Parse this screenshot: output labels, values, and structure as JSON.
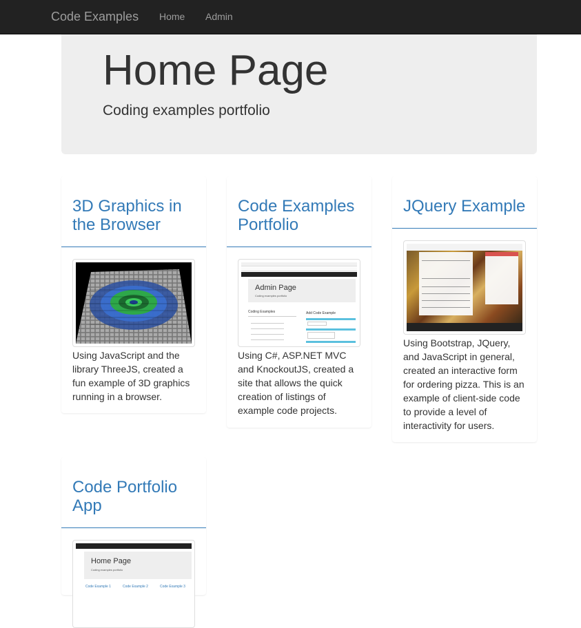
{
  "navbar": {
    "brand": "Code Examples",
    "links": [
      "Home",
      "Admin"
    ]
  },
  "jumbotron": {
    "title": "Home Page",
    "subtitle": "Coding examples portfolio"
  },
  "cards": [
    {
      "title": "3D Graphics in the Browser",
      "text": "Using JavaScript and the library ThreeJS, created a fun example of 3D graphics running in a browser."
    },
    {
      "title": "Code Examples Portfolio",
      "text": "Using C#, ASP.NET MVC and KnockoutJS, created a site that allows the quick creation of listings of example code projects."
    },
    {
      "title": "JQuery Example",
      "text": "Using Bootstrap, JQuery, and JavaScript in general, created an interactive form for ordering pizza. This is an example of client-side code to provide a level of interactivity for users."
    },
    {
      "title": "Code Portfolio App",
      "text": ""
    }
  ],
  "thumbnails": {
    "admin": {
      "title": "Admin Page",
      "subtitle": "Coding examples portfolio",
      "left_label": "Coding Examples",
      "right_label": "Add Code Example"
    },
    "home": {
      "title": "Home Page",
      "subtitle": "Coding examples portfolio",
      "links": [
        "Code Example 1",
        "Code Example 2",
        "Code Example 3"
      ]
    }
  },
  "colors": {
    "navbar_bg": "#222222",
    "link": "#337ab7",
    "jumbotron_bg": "#eeeeee"
  }
}
